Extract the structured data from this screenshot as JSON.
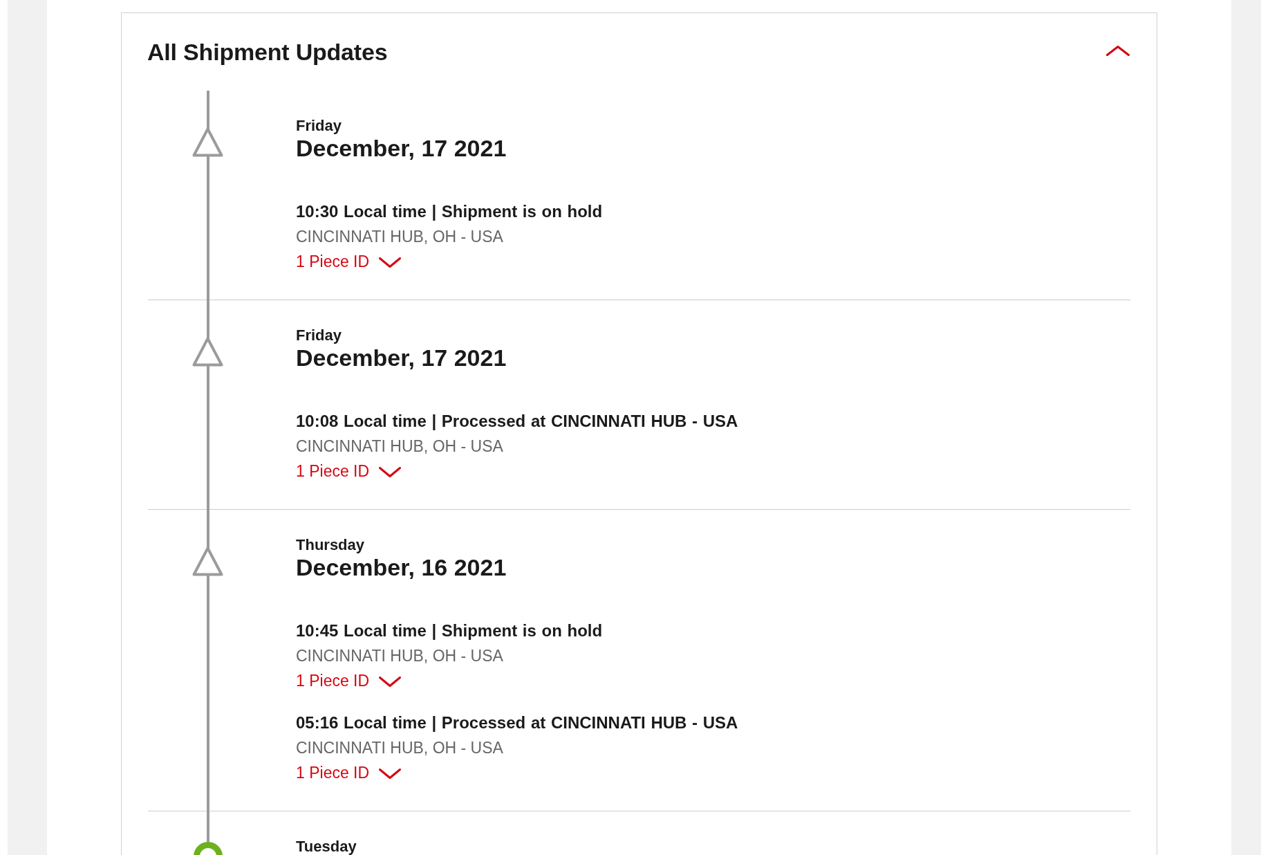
{
  "section": {
    "title": "All Shipment Updates",
    "expanded": true
  },
  "timeline": [
    {
      "kind": "triangle",
      "day": "Friday",
      "date": "December, 17 2021",
      "events": [
        {
          "title": "10:30 Local time | Shipment is on hold",
          "location": "CINCINNATI HUB, OH - USA",
          "piece_toggle": {
            "label": "1 Piece ID",
            "expanded": false
          }
        }
      ]
    },
    {
      "kind": "triangle",
      "day": "Friday",
      "date": "December, 17 2021",
      "events": [
        {
          "title": "10:08 Local time | Processed at CINCINNATI HUB - USA",
          "location": "CINCINNATI HUB, OH - USA",
          "piece_toggle": {
            "label": "1 Piece ID",
            "expanded": false
          }
        }
      ]
    },
    {
      "kind": "triangle",
      "day": "Thursday",
      "date": "December, 16 2021",
      "events": [
        {
          "title": "10:45 Local time | Shipment is on hold",
          "location": "CINCINNATI HUB, OH - USA",
          "piece_toggle": {
            "label": "1 Piece ID",
            "expanded": false
          }
        },
        {
          "title": "05:16 Local time | Processed at CINCINNATI HUB - USA",
          "location": "CINCINNATI HUB, OH - USA",
          "piece_toggle": {
            "label": "1 Piece ID",
            "expanded": false
          }
        }
      ]
    },
    {
      "kind": "circle",
      "day": "Tuesday"
    }
  ]
}
